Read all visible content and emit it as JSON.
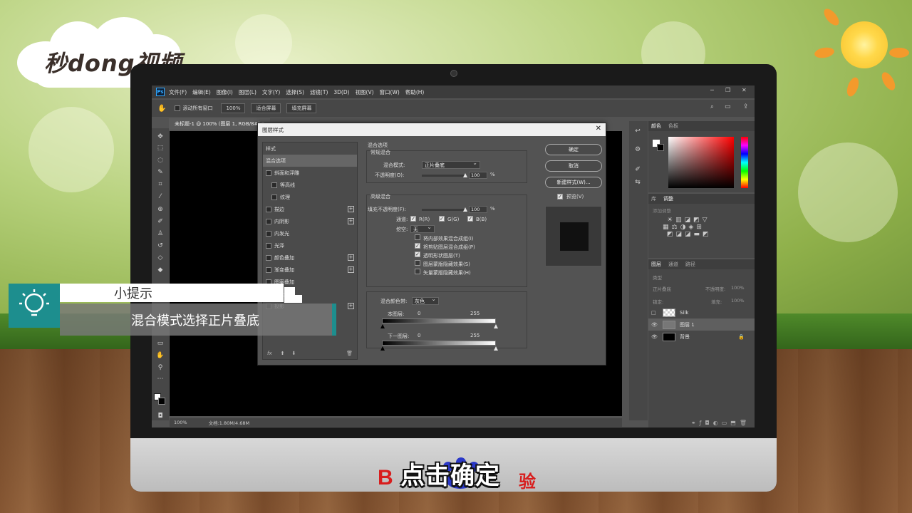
{
  "brand": {
    "logo_text": "秒dong视频"
  },
  "photoshop": {
    "menu": [
      "文件(F)",
      "编辑(E)",
      "图像(I)",
      "图层(L)",
      "文字(Y)",
      "选择(S)",
      "滤镜(T)",
      "3D(D)",
      "视图(V)",
      "窗口(W)",
      "帮助(H)"
    ],
    "options": {
      "scroll_all_windows": "滚动所有窗口",
      "zoom": "100%",
      "fit_screen": "适合屏幕",
      "fill_screen": "填充屏幕"
    },
    "doc_tab": "未标题-1 @ 100% (图层 1, RGB/8#) *",
    "status": {
      "zoom": "100%",
      "doc_size": "文档:1.80M/4.68M"
    },
    "color_panel": {
      "tabs": [
        "颜色",
        "色板"
      ]
    },
    "adjust_panel": {
      "tabs": [
        "库",
        "调整"
      ],
      "hint": "添加调整"
    },
    "layers_panel": {
      "tabs": [
        "图层",
        "通道",
        "路径"
      ],
      "kind": "类型",
      "blend": "正片叠底",
      "opacity_label": "不透明度:",
      "opacity": "100%",
      "lock_label": "锁定:",
      "fill_label": "填充:",
      "fill": "100%",
      "layers": [
        {
          "name": "Silk",
          "visible": false
        },
        {
          "name": "图层 1",
          "visible": true
        },
        {
          "name": "背景",
          "visible": true
        }
      ]
    }
  },
  "dialog": {
    "title": "图层样式",
    "styles_header": "样式",
    "styles": [
      {
        "label": "混合选项",
        "checkbox": false,
        "plus": false
      },
      {
        "label": "斜面和浮雕",
        "checkbox": true,
        "plus": false
      },
      {
        "label": "等高线",
        "checkbox": true,
        "plus": false
      },
      {
        "label": "纹理",
        "checkbox": true,
        "plus": false
      },
      {
        "label": "描边",
        "checkbox": true,
        "plus": true
      },
      {
        "label": "内阴影",
        "checkbox": true,
        "plus": true
      },
      {
        "label": "内发光",
        "checkbox": true,
        "plus": false
      },
      {
        "label": "光泽",
        "checkbox": true,
        "plus": false
      },
      {
        "label": "颜色叠加",
        "checkbox": true,
        "plus": true
      },
      {
        "label": "渐变叠加",
        "checkbox": true,
        "plus": true
      },
      {
        "label": "图案叠加",
        "checkbox": true,
        "plus": false
      },
      {
        "label": "外发光",
        "checkbox": true,
        "plus": false
      },
      {
        "label": "投影",
        "checkbox": true,
        "plus": true
      }
    ],
    "blend_options_title": "混合选项",
    "general_blend_title": "常规混合",
    "blend_mode_label": "混合模式:",
    "blend_mode_value": "正片叠底",
    "opacity_label": "不透明度(O):",
    "opacity_value": "100",
    "advanced_title": "高级混合",
    "fill_opacity_label": "填充不透明度(F):",
    "fill_opacity_value": "100",
    "percent": "%",
    "channels_label": "通道:",
    "channels": [
      "R(R)",
      "G(G)",
      "B(B)"
    ],
    "knockout_label": "挖空:",
    "knockout_value": "无",
    "checks": [
      {
        "label": "将内部效果混合成组(I)",
        "checked": false
      },
      {
        "label": "将剪贴图层混合成组(P)",
        "checked": true
      },
      {
        "label": "透明形状图层(T)",
        "checked": true
      },
      {
        "label": "图层蒙版隐藏效果(S)",
        "checked": false
      },
      {
        "label": "矢量蒙版隐藏效果(H)",
        "checked": false
      }
    ],
    "blend_if_label": "混合颜色带:",
    "blend_if_value": "灰色",
    "this_layer_label": "本图层:",
    "underlying_label": "下一图层:",
    "range_min": "0",
    "range_max": "255",
    "buttons": {
      "ok": "确定",
      "cancel": "取消",
      "new_style": "新建样式(W)...",
      "preview": "预览(V)"
    },
    "preview_checked": true
  },
  "tip": {
    "title": "小提示",
    "body": "混合模式选择正片叠底"
  },
  "caption": "点击确定",
  "colors": {
    "accent_teal": "#1d8e8e",
    "ps_dark": "#535353",
    "baidu_red": "#d81d1d",
    "baidu_blue": "#2a38c8"
  }
}
